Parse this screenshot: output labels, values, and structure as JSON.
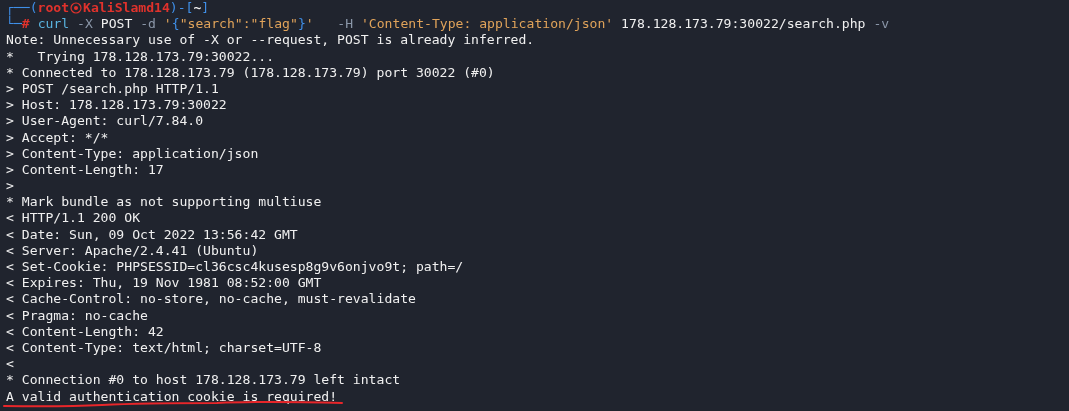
{
  "prompt": {
    "frame_open": "┌──(",
    "user": "root",
    "host": "KaliSlamd14",
    "frame_mid": ")-[",
    "cwd": "~",
    "frame_close": "]",
    "frame_lower": "└─",
    "symbol": "#"
  },
  "command": [
    {
      "text": "curl",
      "kind": "command"
    },
    {
      "text": " -X",
      "kind": "option"
    },
    {
      "text": " POST",
      "kind": "plain"
    },
    {
      "text": " -d",
      "kind": "option"
    },
    {
      "text": " '",
      "kind": "string"
    },
    {
      "text": "{",
      "kind": "brace"
    },
    {
      "text": "\"search\":\"flag\"",
      "kind": "string"
    },
    {
      "text": "}",
      "kind": "brace"
    },
    {
      "text": "'",
      "kind": "string"
    },
    {
      "text": "   -H",
      "kind": "option"
    },
    {
      "text": " 'Content-Type: application/json'",
      "kind": "string"
    },
    {
      "text": " 178.128.173.79:30022/search.php",
      "kind": "plain"
    },
    {
      "text": " -v",
      "kind": "option"
    }
  ],
  "output": [
    "Note: Unnecessary use of -X or --request, POST is already inferred.",
    "*   Trying 178.128.173.79:30022...",
    "* Connected to 178.128.173.79 (178.128.173.79) port 30022 (#0)",
    "> POST /search.php HTTP/1.1",
    "> Host: 178.128.173.79:30022",
    "> User-Agent: curl/7.84.0",
    "> Accept: */*",
    "> Content-Type: application/json",
    "> Content-Length: 17",
    ">",
    "* Mark bundle as not supporting multiuse",
    "< HTTP/1.1 200 OK",
    "< Date: Sun, 09 Oct 2022 13:56:42 GMT",
    "< Server: Apache/2.4.41 (Ubuntu)",
    "< Set-Cookie: PHPSESSID=cl36csc4kusesp8g9v6onjvo9t; path=/",
    "< Expires: Thu, 19 Nov 1981 08:52:00 GMT",
    "< Cache-Control: no-store, no-cache, must-revalidate",
    "< Pragma: no-cache",
    "< Content-Length: 42",
    "< Content-Type: text/html; charset=UTF-8",
    "<",
    "* Connection #0 to host 178.128.173.79 left intact"
  ],
  "result": {
    "text": "A valid authentication cookie is required!",
    "underlined": true
  }
}
